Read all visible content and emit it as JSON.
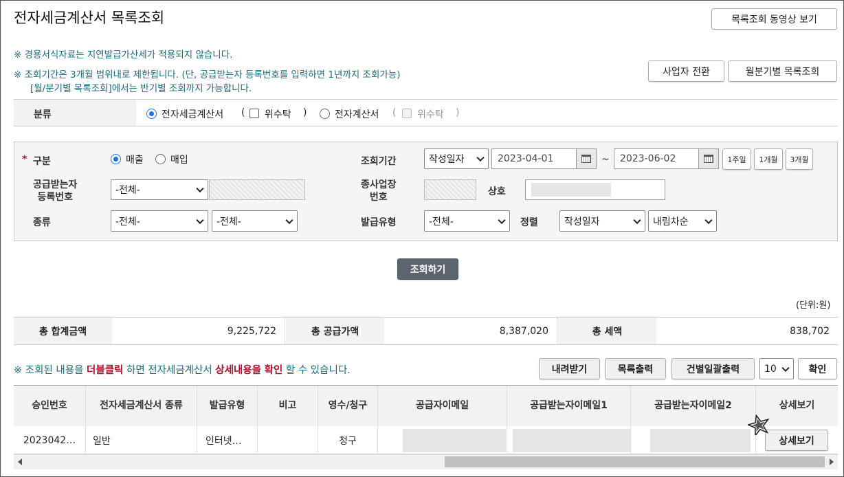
{
  "page": {
    "title": "전자세금계산서 목록조회",
    "video_button": "목록조회 동영상 보기",
    "notice1": "※ 경용서식자료는 지연발급가산세가 적용되지 않습니다.",
    "notice2": "※ 조회기간은 3개월 범위내로 제한됩니다. (단, 공급받는자 등록번호를 입력하면 1년까지 조회가능)",
    "notice3": "[월/분기별 목록조회]에서는 반기별 조회까지 가능합니다.",
    "switch_business_button": "사업자 전환",
    "monthly_list_button": "월분기별 목록조회"
  },
  "category": {
    "label": "분류",
    "option1": "전자세금계산서",
    "option1_paren_open": "(",
    "option1_check": "위수탁",
    "option1_paren_close": ")",
    "option2": "전자계산서",
    "option2_paren_open": "(",
    "option2_check": "위수탁",
    "option2_paren_close": ")"
  },
  "search": {
    "type_label": "구분",
    "required_mark": "*",
    "sales": "매출",
    "purchase": "매입",
    "period_label": "조회기간",
    "date_type": "작성일자",
    "start_date": "2023-04-01",
    "tilde": "~",
    "end_date": "2023-06-02",
    "one_week": "1주일",
    "one_month": "1개월",
    "three_months": "3개월",
    "buyer_reg_label_1": "공급받는자",
    "buyer_reg_label_2": "등록번호",
    "buyer_reg_select": "-전체-",
    "branch_label_1": "종사업장",
    "branch_label_2": "번호",
    "company_label": "상호",
    "kind_label": "종류",
    "kind_select1": "-전체-",
    "kind_select2": "-전체-",
    "issue_type_label": "발급유형",
    "issue_type_select": "-전체-",
    "sort_label": "정렬",
    "sort_field": "작성일자",
    "sort_order": "내림차순",
    "search_button": "조회하기"
  },
  "totals": {
    "unit": "(단위:원)",
    "total_label": "총 합계금액",
    "total_value": "9,225,722",
    "supply_label": "총 공급가액",
    "supply_value": "8,387,020",
    "tax_label": "총 세액",
    "tax_value": "838,702"
  },
  "list_toolbar": {
    "hint_prefix": "※ 조회된 내용을 ",
    "hint_dbl": "더블클릭",
    "hint_mid": " 하면 전자세금계산서 ",
    "hint_detail": "상세내용을",
    "hint_space": " ",
    "hint_confirm": "확인",
    "hint_suffix": " 할 수 있습니다.",
    "download": "내려받기",
    "print_list": "목록출력",
    "batch_print": "건별일괄출력",
    "page_size": "10",
    "ok": "확인"
  },
  "table": {
    "headers": [
      "승인번호",
      "전자세금계산서 종류",
      "발급유형",
      "비고",
      "영수/청구",
      "공급자이메일",
      "공급받는자이메일1",
      "공급받는자이메일2",
      "상세보기"
    ],
    "row": {
      "approval_no": "2023042…",
      "kind": "일반",
      "issue_type": "인터넷…",
      "note": "",
      "receipt": "청구",
      "detail_button": "상세보기"
    }
  },
  "colors": {
    "accent": "#1a73e8",
    "notice": "#1a6a7a",
    "highlight_red": "#b0102a",
    "dark_button": "#5c6470"
  }
}
